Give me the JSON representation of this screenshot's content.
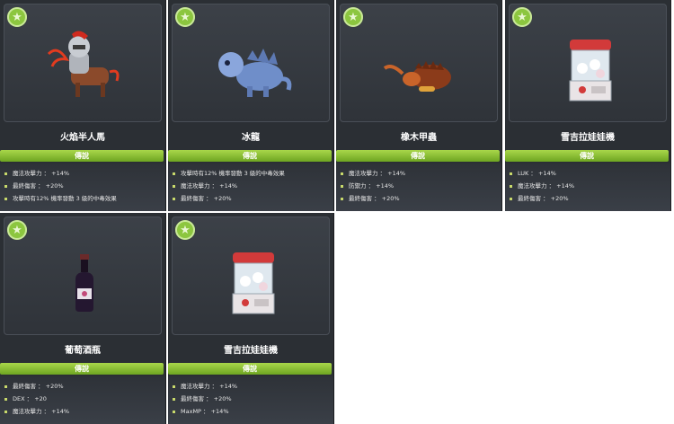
{
  "cards": [
    {
      "name": "火焰半人馬",
      "rank": "傳說",
      "icon": "star-icon",
      "stats": [
        "魔法攻擊力 ： +14%",
        "最終傷害 ： +20%",
        "攻擊時有12% 機率發動 3 級的中毒效果"
      ]
    },
    {
      "name": "冰龍",
      "rank": "傳說",
      "icon": "star-icon",
      "stats": [
        "攻擊時有12% 機率發動 3 級的中毒效果",
        "魔法攻擊力 ： +14%",
        "最終傷害 ： +20%"
      ]
    },
    {
      "name": "橡木甲蟲",
      "rank": "傳說",
      "icon": "star-icon",
      "stats": [
        "魔法攻擊力 ： +14%",
        "防禦力 ： +14%",
        "最終傷害 ： +20%"
      ]
    },
    {
      "name": "雪吉拉娃娃機",
      "rank": "傳說",
      "icon": "star-icon",
      "stats": [
        "LUK ： +14%",
        "魔法攻擊力 ： +14%",
        "最終傷害 ： +20%"
      ]
    },
    {
      "name": "葡萄酒瓶",
      "rank": "傳說",
      "icon": "star-icon",
      "stats": [
        "最終傷害 ： +20%",
        "DEX ： +20",
        "魔法攻擊力 ： +14%"
      ]
    },
    {
      "name": "雪吉拉娃娃機",
      "rank": "傳說",
      "icon": "star-icon",
      "stats": [
        "魔法攻擊力 ： +14%",
        "最終傷害 ： +20%",
        "MaxMP ： +14%"
      ]
    }
  ],
  "colors": {
    "rank_green": "#8cc63f",
    "panel": "#2b2f34"
  }
}
